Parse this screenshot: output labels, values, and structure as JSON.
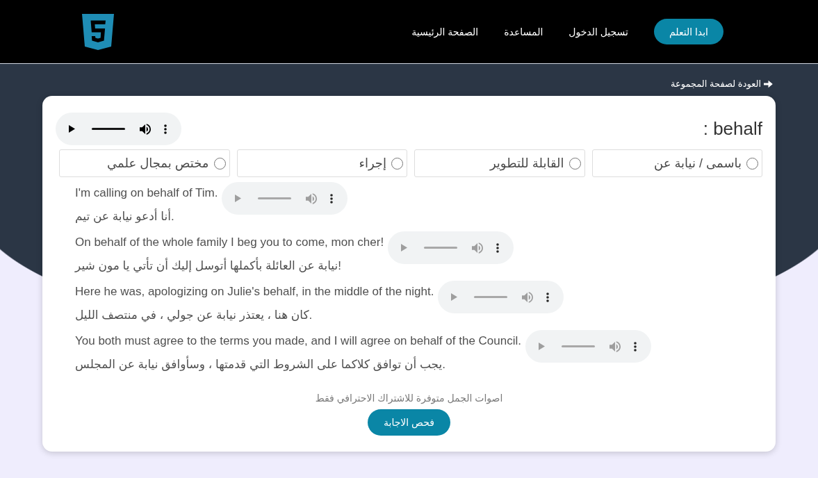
{
  "header": {
    "cta_button": "ابدا التعلم",
    "nav_links": [
      "تسجيل الدخول",
      "المساعدة",
      "الصفحة الرئيسية"
    ]
  },
  "back_link": "العودة لصفحة المجموعة",
  "question": {
    "word": "behalf :",
    "audio": {
      "disabled": false
    }
  },
  "options": [
    {
      "label": "باسمى / نيابة عن",
      "selected": false
    },
    {
      "label": "القابلة للتطوير",
      "selected": false
    },
    {
      "label": "إجراء",
      "selected": false
    },
    {
      "label": "مختص بمجال علمي",
      "selected": false
    }
  ],
  "examples": [
    {
      "english": "I'm calling on behalf of Tim.",
      "arabic": "أنا أدعو نيابة عن تيم.",
      "audio": {
        "disabled": true
      }
    },
    {
      "english": "On behalf of the whole family I beg you to come, mon cher!",
      "arabic": "نيابة عن العائلة بأكملها أتوسل إليك أن تأتي يا مون شير!",
      "audio": {
        "disabled": true
      }
    },
    {
      "english": "Here he was, apologizing on Julie's behalf, in the middle of the night.",
      "arabic": "كان هنا ، يعتذر نيابة عن جولي ، في منتصف الليل.",
      "audio": {
        "disabled": true
      }
    },
    {
      "english": "You both must agree to the terms you made, and I will agree on behalf of the Council.",
      "arabic": "يجب أن توافق كلاكما على الشروط التي قدمتها ، وسأوافق نيابة عن المجلس.",
      "audio": {
        "disabled": true
      }
    }
  ],
  "note": "اصوات الجمل متوفرة للاشتراك الاحترافي فقط",
  "check_button": "فحص الاجابة"
}
